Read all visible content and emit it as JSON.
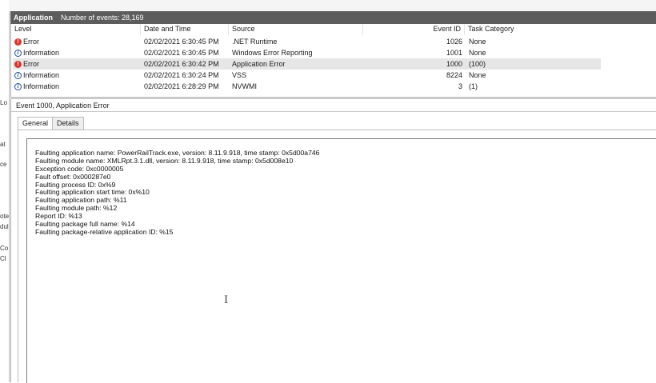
{
  "left_fragments": [
    "Lo",
    "at",
    "ce",
    "ote",
    "dul",
    "Co",
    "Cl"
  ],
  "header": {
    "title": "Application",
    "count": "Number of events: 28,169"
  },
  "events": {
    "columns": [
      "Level",
      "Date and Time",
      "Source",
      "Event ID",
      "Task Category"
    ],
    "rows": [
      {
        "level": "Error",
        "icon": "error-icon",
        "date": "02/02/2021 6:30:45 PM",
        "source": ".NET Runtime",
        "event_id": "1026",
        "task": "None",
        "selected": false
      },
      {
        "level": "Information",
        "icon": "info-icon",
        "date": "02/02/2021 6:30:45 PM",
        "source": "Windows Error Reporting",
        "event_id": "1001",
        "task": "None",
        "selected": false
      },
      {
        "level": "Error",
        "icon": "error-icon",
        "date": "02/02/2021 6:30:42 PM",
        "source": "Application Error",
        "event_id": "1000",
        "task": "(100)",
        "selected": true
      },
      {
        "level": "Information",
        "icon": "info-icon",
        "date": "02/02/2021 6:30:24 PM",
        "source": "VSS",
        "event_id": "8224",
        "task": "None",
        "selected": false
      },
      {
        "level": "Information",
        "icon": "info-icon",
        "date": "02/02/2021 6:28:29 PM",
        "source": "NVWMI",
        "event_id": "3",
        "task": "(1)",
        "selected": false
      }
    ]
  },
  "detail": {
    "title": "Event 1000, Application Error",
    "tabs": [
      "General",
      "Details"
    ],
    "active_tab": "General",
    "description": [
      "Faulting application name: PowerRailTrack.exe, version: 8.11.9.918, time stamp: 0x5d00a746",
      "Faulting module name: XMLRpt.3.1.dll, version: 8.11.9.918, time stamp: 0x5d008e10",
      "Exception code: 0xc0000005",
      "Fault offset: 0x000287e0",
      "Faulting process ID: 0x%9",
      "Faulting application start time: 0x%10",
      "Faulting application path: %11",
      "Faulting module path: %12",
      "Report ID: %13",
      "Faulting package full name: %14",
      "Faulting package-relative application ID: %15"
    ]
  },
  "colors": {
    "header_bg": "#5d5d5d",
    "selected_row": "#e6e6e6",
    "error": "#d9362b",
    "info": "#1a4f9c"
  }
}
